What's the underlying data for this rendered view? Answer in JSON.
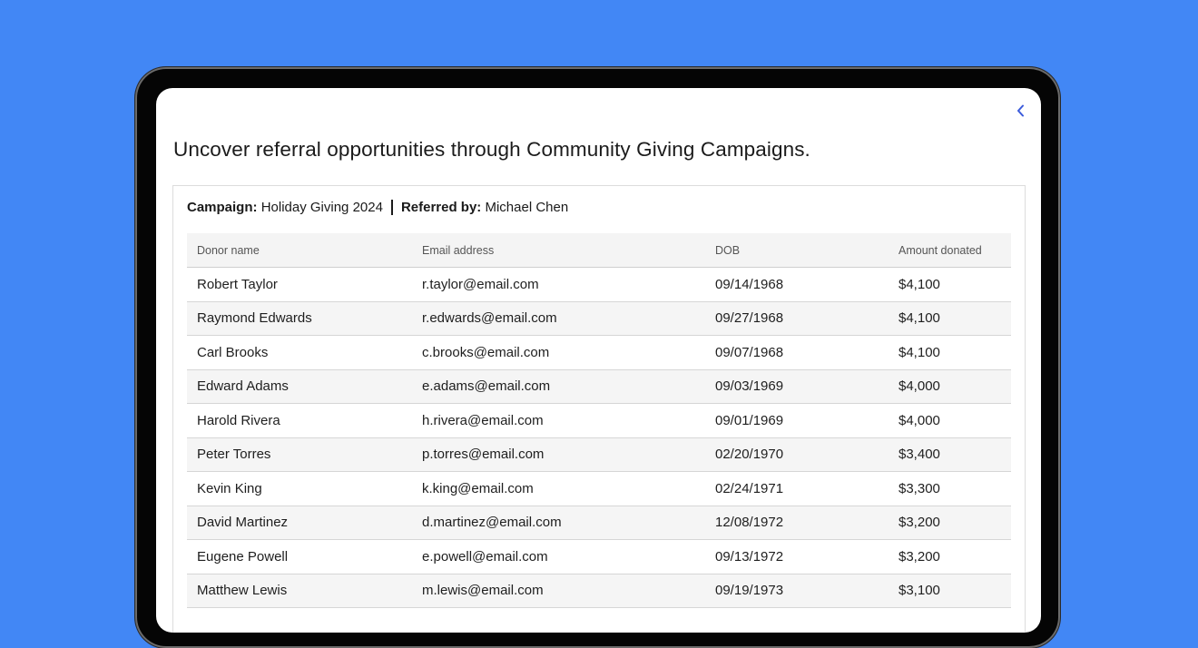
{
  "page": {
    "headline": "Uncover referral opportunities through Community Giving Campaigns.",
    "back_icon": "chevron-left-icon",
    "accent_color": "#3b5bdb",
    "background_color": "#4287f5"
  },
  "campaign": {
    "campaign_label": "Campaign:",
    "campaign_value": "Holiday Giving 2024",
    "referred_label": "Referred by:",
    "referred_value": "Michael Chen"
  },
  "table": {
    "headers": [
      "Donor name",
      "Email address",
      "DOB",
      "Amount donated"
    ],
    "rows": [
      [
        "Robert Taylor",
        "r.taylor@email.com",
        "09/14/1968",
        "$4,100"
      ],
      [
        "Raymond Edwards",
        "r.edwards@email.com",
        "09/27/1968",
        "$4,100"
      ],
      [
        "Carl Brooks",
        "c.brooks@email.com",
        "09/07/1968",
        "$4,100"
      ],
      [
        "Edward Adams",
        "e.adams@email.com",
        "09/03/1969",
        "$4,000"
      ],
      [
        "Harold Rivera",
        "h.rivera@email.com",
        "09/01/1969",
        "$4,000"
      ],
      [
        "Peter Torres",
        "p.torres@email.com",
        "02/20/1970",
        "$3,400"
      ],
      [
        "Kevin King",
        "k.king@email.com",
        "02/24/1971",
        "$3,300"
      ],
      [
        "David Martinez",
        "d.martinez@email.com",
        "12/08/1972",
        "$3,200"
      ],
      [
        "Eugene Powell",
        "e.powell@email.com",
        "09/13/1972",
        "$3,200"
      ],
      [
        "Matthew Lewis",
        "m.lewis@email.com",
        "09/19/1973",
        "$3,100"
      ]
    ]
  }
}
